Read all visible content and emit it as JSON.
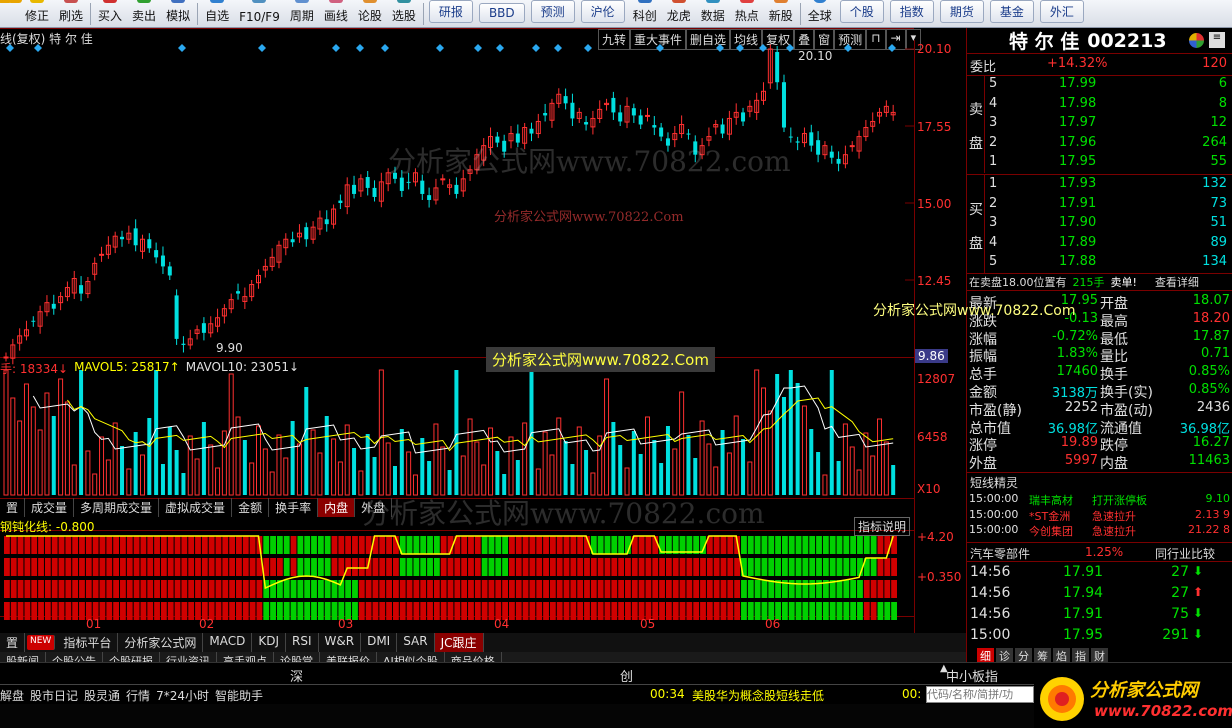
{
  "toolbar": {
    "items": [
      "修正",
      "刷选",
      "买入",
      "卖出",
      "模拟",
      "自选",
      "F10/F9",
      "周期",
      "画线",
      "论股",
      "选股"
    ],
    "round_buttons": [
      "研报",
      "BBD",
      "预测",
      "沪伦",
      "科创",
      "龙虎",
      "数据",
      "热点",
      "新股",
      "全球"
    ],
    "market_tabs": [
      "个股",
      "指数",
      "期货",
      "基金",
      "外汇"
    ]
  },
  "chart_header": {
    "title": "线(复权)  特 尔 佳",
    "buttons": [
      "九转",
      "重大事件",
      "删自选",
      "均线",
      "复权",
      "叠",
      "窗",
      "预测"
    ]
  },
  "price_axis": [
    "20.10",
    "17.55",
    "15.00",
    "12.45",
    "9.86"
  ],
  "price_labels": {
    "high": "20.10",
    "low": "9.90"
  },
  "volume_header": {
    "vol": "手: 18334↓",
    "mavol5": "MAVOL5: 25817↑",
    "mavol10": "MAVOL10: 23051↓"
  },
  "volume_axis": [
    "12807",
    "6458",
    "X10"
  ],
  "indicator_tabs": [
    "置",
    "成交量",
    "多周期成交量",
    "虚拟成交量",
    "金额",
    "换手率",
    "内盘",
    "外盘"
  ],
  "indicator_header": {
    "label": "钢钝化线: -0.800",
    "explain": "指标说明"
  },
  "indicator_axis": [
    "+4.20",
    "+0.350"
  ],
  "months": [
    "01",
    "02",
    "03",
    "04",
    "05",
    "06"
  ],
  "bottom_tabs": [
    "置",
    "指标平台",
    "分析家公式网",
    "MACD",
    "KDJ",
    "RSI",
    "W&R",
    "DMI",
    "SAR",
    "JC跟庄"
  ],
  "bottom_badge": "NEW",
  "info_tabs": [
    "股新闻",
    "个股公告",
    "个股研报",
    "行业资讯",
    "高手观点",
    "论股堂",
    "美联报价",
    "AI相似个股",
    "商品价格"
  ],
  "status": {
    "left": "深",
    "mid": "创",
    "right": "中小板指"
  },
  "bottom_links": [
    "解盘",
    "股市日记",
    "股灵通",
    "行情",
    "7*24小时",
    "智能助手"
  ],
  "news": {
    "time": "00:34",
    "text": "美股华为概念股短线走低",
    "time2": "00:"
  },
  "search_placeholder": "代码/名称/简拼/功",
  "watermarks": [
    "分析家公式网www.70822.com",
    "分析家公式网www.70822.Com"
  ],
  "logo": {
    "text": "分析家公式网",
    "url": "www.70822.com"
  },
  "stock": {
    "name": "特 尔 佳",
    "code": "002213"
  },
  "weibi": {
    "label": "委比",
    "value": "+14.32%",
    "extra": "120"
  },
  "sell_orders": [
    {
      "n": "5",
      "p": "17.99",
      "v": "6"
    },
    {
      "n": "4",
      "p": "17.98",
      "v": "8"
    },
    {
      "n": "3",
      "p": "17.97",
      "v": "12"
    },
    {
      "n": "2",
      "p": "17.96",
      "v": "264"
    },
    {
      "n": "1",
      "p": "17.95",
      "v": "55"
    }
  ],
  "buy_orders": [
    {
      "n": "1",
      "p": "17.93",
      "v": "132"
    },
    {
      "n": "2",
      "p": "17.91",
      "v": "73"
    },
    {
      "n": "3",
      "p": "17.90",
      "v": "51"
    },
    {
      "n": "4",
      "p": "17.89",
      "v": "89"
    },
    {
      "n": "5",
      "p": "17.88",
      "v": "134"
    }
  ],
  "side_labels": {
    "sell": [
      "卖",
      "盘"
    ],
    "buy": [
      "买",
      "盘"
    ]
  },
  "sell_notice": {
    "text": "在卖盘18.00位置有",
    "vol": "215手",
    "action": "卖单!",
    "detail": "查看详细"
  },
  "quotes": [
    {
      "l1": "最新",
      "v1": "17.95",
      "l2": "开盘",
      "v2": "18.07"
    },
    {
      "l1": "涨跌",
      "v1": "-0.13",
      "l2": "最高",
      "v2": "18.20"
    },
    {
      "l1": "涨幅",
      "v1": "-0.72%",
      "l2": "最低",
      "v2": "17.87"
    },
    {
      "l1": "振幅",
      "v1": "1.83%",
      "l2": "量比",
      "v2": "0.71"
    },
    {
      "l1": "总手",
      "v1": "17460",
      "l2": "换手",
      "v2": "0.85%"
    },
    {
      "l1": "金额",
      "v1": "3138万",
      "l2": "换手(实)",
      "v2": "0.85%"
    },
    {
      "l1": "市盈(静)",
      "v1": "2252",
      "l2": "市盈(动)",
      "v2": "2436"
    },
    {
      "l1": "总市值",
      "v1": "36.98亿",
      "l2": "流通值",
      "v2": "36.98亿"
    },
    {
      "l1": "涨停",
      "v1": "19.89",
      "l2": "跌停",
      "v2": "16.27"
    },
    {
      "l1": "外盘",
      "v1": "5997",
      "l2": "内盘",
      "v2": "11463"
    }
  ],
  "short_elf": {
    "title": "短线精灵",
    "items": [
      {
        "t": "15:00:00",
        "name": "瑞丰高材",
        "ev": "打开涨停板",
        "val": "9.10"
      },
      {
        "t": "15:00:00",
        "name": "*ST金洲",
        "ev": "急速拉升",
        "val": "2.13 9"
      },
      {
        "t": "15:00:00",
        "name": "今创集团",
        "ev": "急速拉升",
        "val": "21.22 8"
      }
    ]
  },
  "sector": {
    "name": "汽车零部件",
    "pct": "1.25%",
    "compare": "同行业比较"
  },
  "ticks": [
    {
      "t": "14:56",
      "p": "17.91",
      "v": "27",
      "dir": "down"
    },
    {
      "t": "14:56",
      "p": "17.94",
      "v": "27",
      "dir": "up"
    },
    {
      "t": "14:56",
      "p": "17.91",
      "v": "75",
      "dir": "down"
    },
    {
      "t": "15:00",
      "p": "17.95",
      "v": "291",
      "dir": "down"
    }
  ],
  "panel_tabs": [
    "细",
    "诊",
    "分",
    "筹",
    "焰",
    "指",
    "财"
  ],
  "colors": {
    "up": "#ff3030",
    "down": "#00e0e0",
    "green": "#00e000",
    "axis": "#7a0000"
  }
}
